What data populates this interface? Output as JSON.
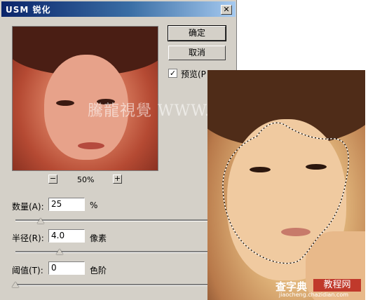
{
  "window": {
    "title": "USM 锐化",
    "close_label": "✕"
  },
  "buttons": {
    "ok_label": "确定",
    "cancel_label": "取消"
  },
  "preview_checkbox": {
    "label": "预览(P",
    "checked": true,
    "check_glyph": "✓"
  },
  "zoom": {
    "minus_label": "−",
    "plus_label": "+",
    "value": "50%"
  },
  "controls": [
    {
      "label": "数量(A):",
      "value": "25",
      "unit": "%",
      "slider_fraction": 0.13
    },
    {
      "label": "半径(R):",
      "value": "4.0",
      "unit": "像素",
      "slider_fraction": 0.23
    },
    {
      "label": "阈值(T):",
      "value": "0",
      "unit": "色阶",
      "slider_fraction": 0.0
    }
  ],
  "preview_watermark": "騰龍視覺 WWW.TLVI.NET",
  "site_watermark": {
    "name": "查字典",
    "badge": "教程网",
    "url": "jiaocheng.chazidian.com"
  }
}
